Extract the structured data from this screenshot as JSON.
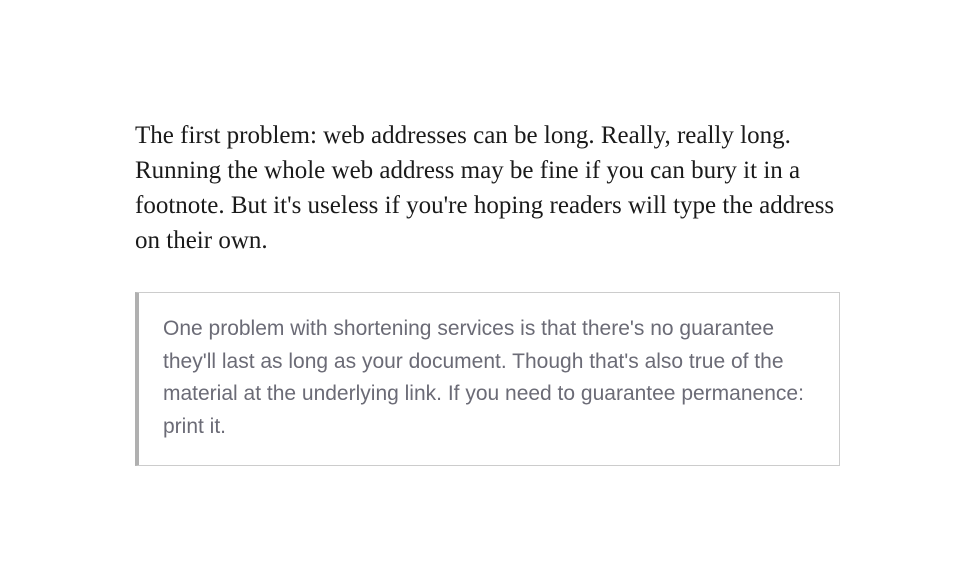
{
  "main": {
    "paragraph": "The first problem: web addresses can be long. Really, really long. Running the whole web address may be fine if you can bury it in a footnote. But it's useless if you're hoping readers will type the address on their own."
  },
  "note": {
    "text": "One problem with shortening services is that there's no guarantee they'll last as long as your document. Though that's also true of the material at the underlying link. If you need to guarantee permanence: print it."
  }
}
